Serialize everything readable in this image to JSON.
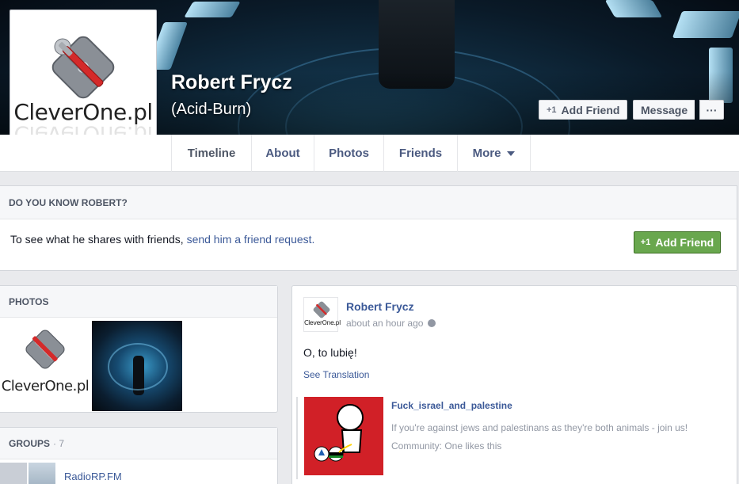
{
  "profile": {
    "name": "Robert Frycz",
    "nickname": "(Acid-Burn)",
    "logo_text": "CleverOne.pl"
  },
  "actions": {
    "add_friend": "Add Friend",
    "message": "Message",
    "more": "···"
  },
  "tabs": [
    {
      "label": "Timeline",
      "active": true
    },
    {
      "label": "About"
    },
    {
      "label": "Photos"
    },
    {
      "label": "Friends"
    },
    {
      "label": "More"
    }
  ],
  "know_box": {
    "heading": "DO YOU KNOW ROBERT?",
    "text": "To see what he shares with friends, ",
    "link": "send him a friend request.",
    "button": "Add Friend"
  },
  "photos": {
    "heading": "PHOTOS"
  },
  "groups": {
    "heading": "GROUPS",
    "count": "· 7",
    "first_group": "RadioRP.FM"
  },
  "post": {
    "author": "Robert Frycz",
    "time": "about an hour ago",
    "text": "O, to lubię!",
    "see_translation": "See Translation",
    "attachment": {
      "title": "Fuck_israel_and_palestine",
      "description": "If you're against jews and palestinans as they're both animals - join us!",
      "meta": "Community: One likes this"
    }
  },
  "colors": {
    "link": "#3b5998",
    "green_button": "#69a74e",
    "page_bg": "#e9eaed"
  },
  "icons": [
    "add-friend-icon",
    "globe-icon",
    "caret-down-icon",
    "wrench-screwdriver-logo"
  ]
}
